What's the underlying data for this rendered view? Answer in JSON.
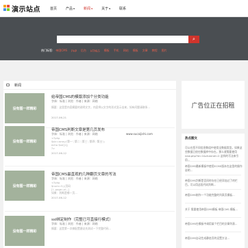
{
  "header": {
    "logo_text": "演示站点",
    "nav": [
      {
        "label": "首页",
        "caret": false,
        "active": false
      },
      {
        "label": "产品",
        "caret": true,
        "active": false
      },
      {
        "label": "新闻",
        "caret": true,
        "active": true
      },
      {
        "label": "关于",
        "caret": true,
        "active": false
      },
      {
        "label": "联系",
        "caret": false,
        "active": false
      }
    ]
  },
  "banner": {
    "search_placeholder": "",
    "search_icon": "magnifier-icon",
    "hot_label": "热门标签:",
    "hot_tags": [
      "帝国CMS",
      "PHP",
      "后台",
      "HTML5",
      "模板",
      "手机",
      "网站",
      "模板",
      "文章",
      "教程",
      "图片"
    ]
  },
  "main": {
    "section_title": "新闻",
    "thumb_text": "没有图一样精彩",
    "articles": [
      {
        "title": "给帝国CMS的模版添加个分类功能",
        "meta": "字体：标准 | 浏览：作者 | 来源：网络",
        "lines": [
          "摘要：这里是内容摘要的说明文字，内容将以文字的形式显示出来，如有问题请联系..."
        ],
        "date": "2017-06-21"
      },
      {
        "title": "帝国CMS判断文章是第几页发布",
        "meta": "字体：标准 | 浏览：作者 | 来源：网络",
        "lines": [
          "<?php",
          "$str=array('第一','第二','第三','第四','第五');",
          "echo $str[1];",
          "?>"
        ],
        "date": "2017-06-12"
      },
      {
        "title": "帝国CMS最直观的几种翻页文章的写法",
        "meta": "字体：标准 | 浏览：作者 | 来源：网络",
        "lines": [
          "<?php",
          "$num=5;//页码",
          "[!--page.url--]",
          "如果：判断是哪一页..."
        ],
        "date": "2017-06-12"
      },
      {
        "title": "ssl绑定制作（完整已可直接行模式）",
        "meta": "字体：标准 | 浏览：作者 | 来源：网络",
        "lines": [
          "摘要：这是第一次做配置建议先测试一下完整代码..."
        ],
        "date": ""
      }
    ],
    "watermark": "www.sucaijishi.com"
  },
  "sidebar": {
    "ad_text": "广告位正在招租",
    "section_title": "热点图文",
    "items": [
      "可以在您不同信息数组中使用全数据类型。如果这些数据已经在数据库中存在，那么就需要使用 new.php?id=1&channel=2 这样的写法来引用...",
      "帝国CMS最新模板中使用ECMS版本在这里的操作说明...",
      "帝国CMS判断是否同时存在已经添加过了的栏目，可以用这段代码判断...",
      "帝国CMS制作一个功能完整的列表页模板...",
      "关于 需要使用帝国CMS模板 帝国CMS 模板...",
      "帝国CMS在模板中调用某个栏目的文章列表...",
      "帝国CMS自动生成静态页的设置方法..."
    ]
  },
  "colors": {
    "accent": "#d0342c",
    "banner_bg": "#4a4e52",
    "thumb_bg": "#a3b29c"
  }
}
